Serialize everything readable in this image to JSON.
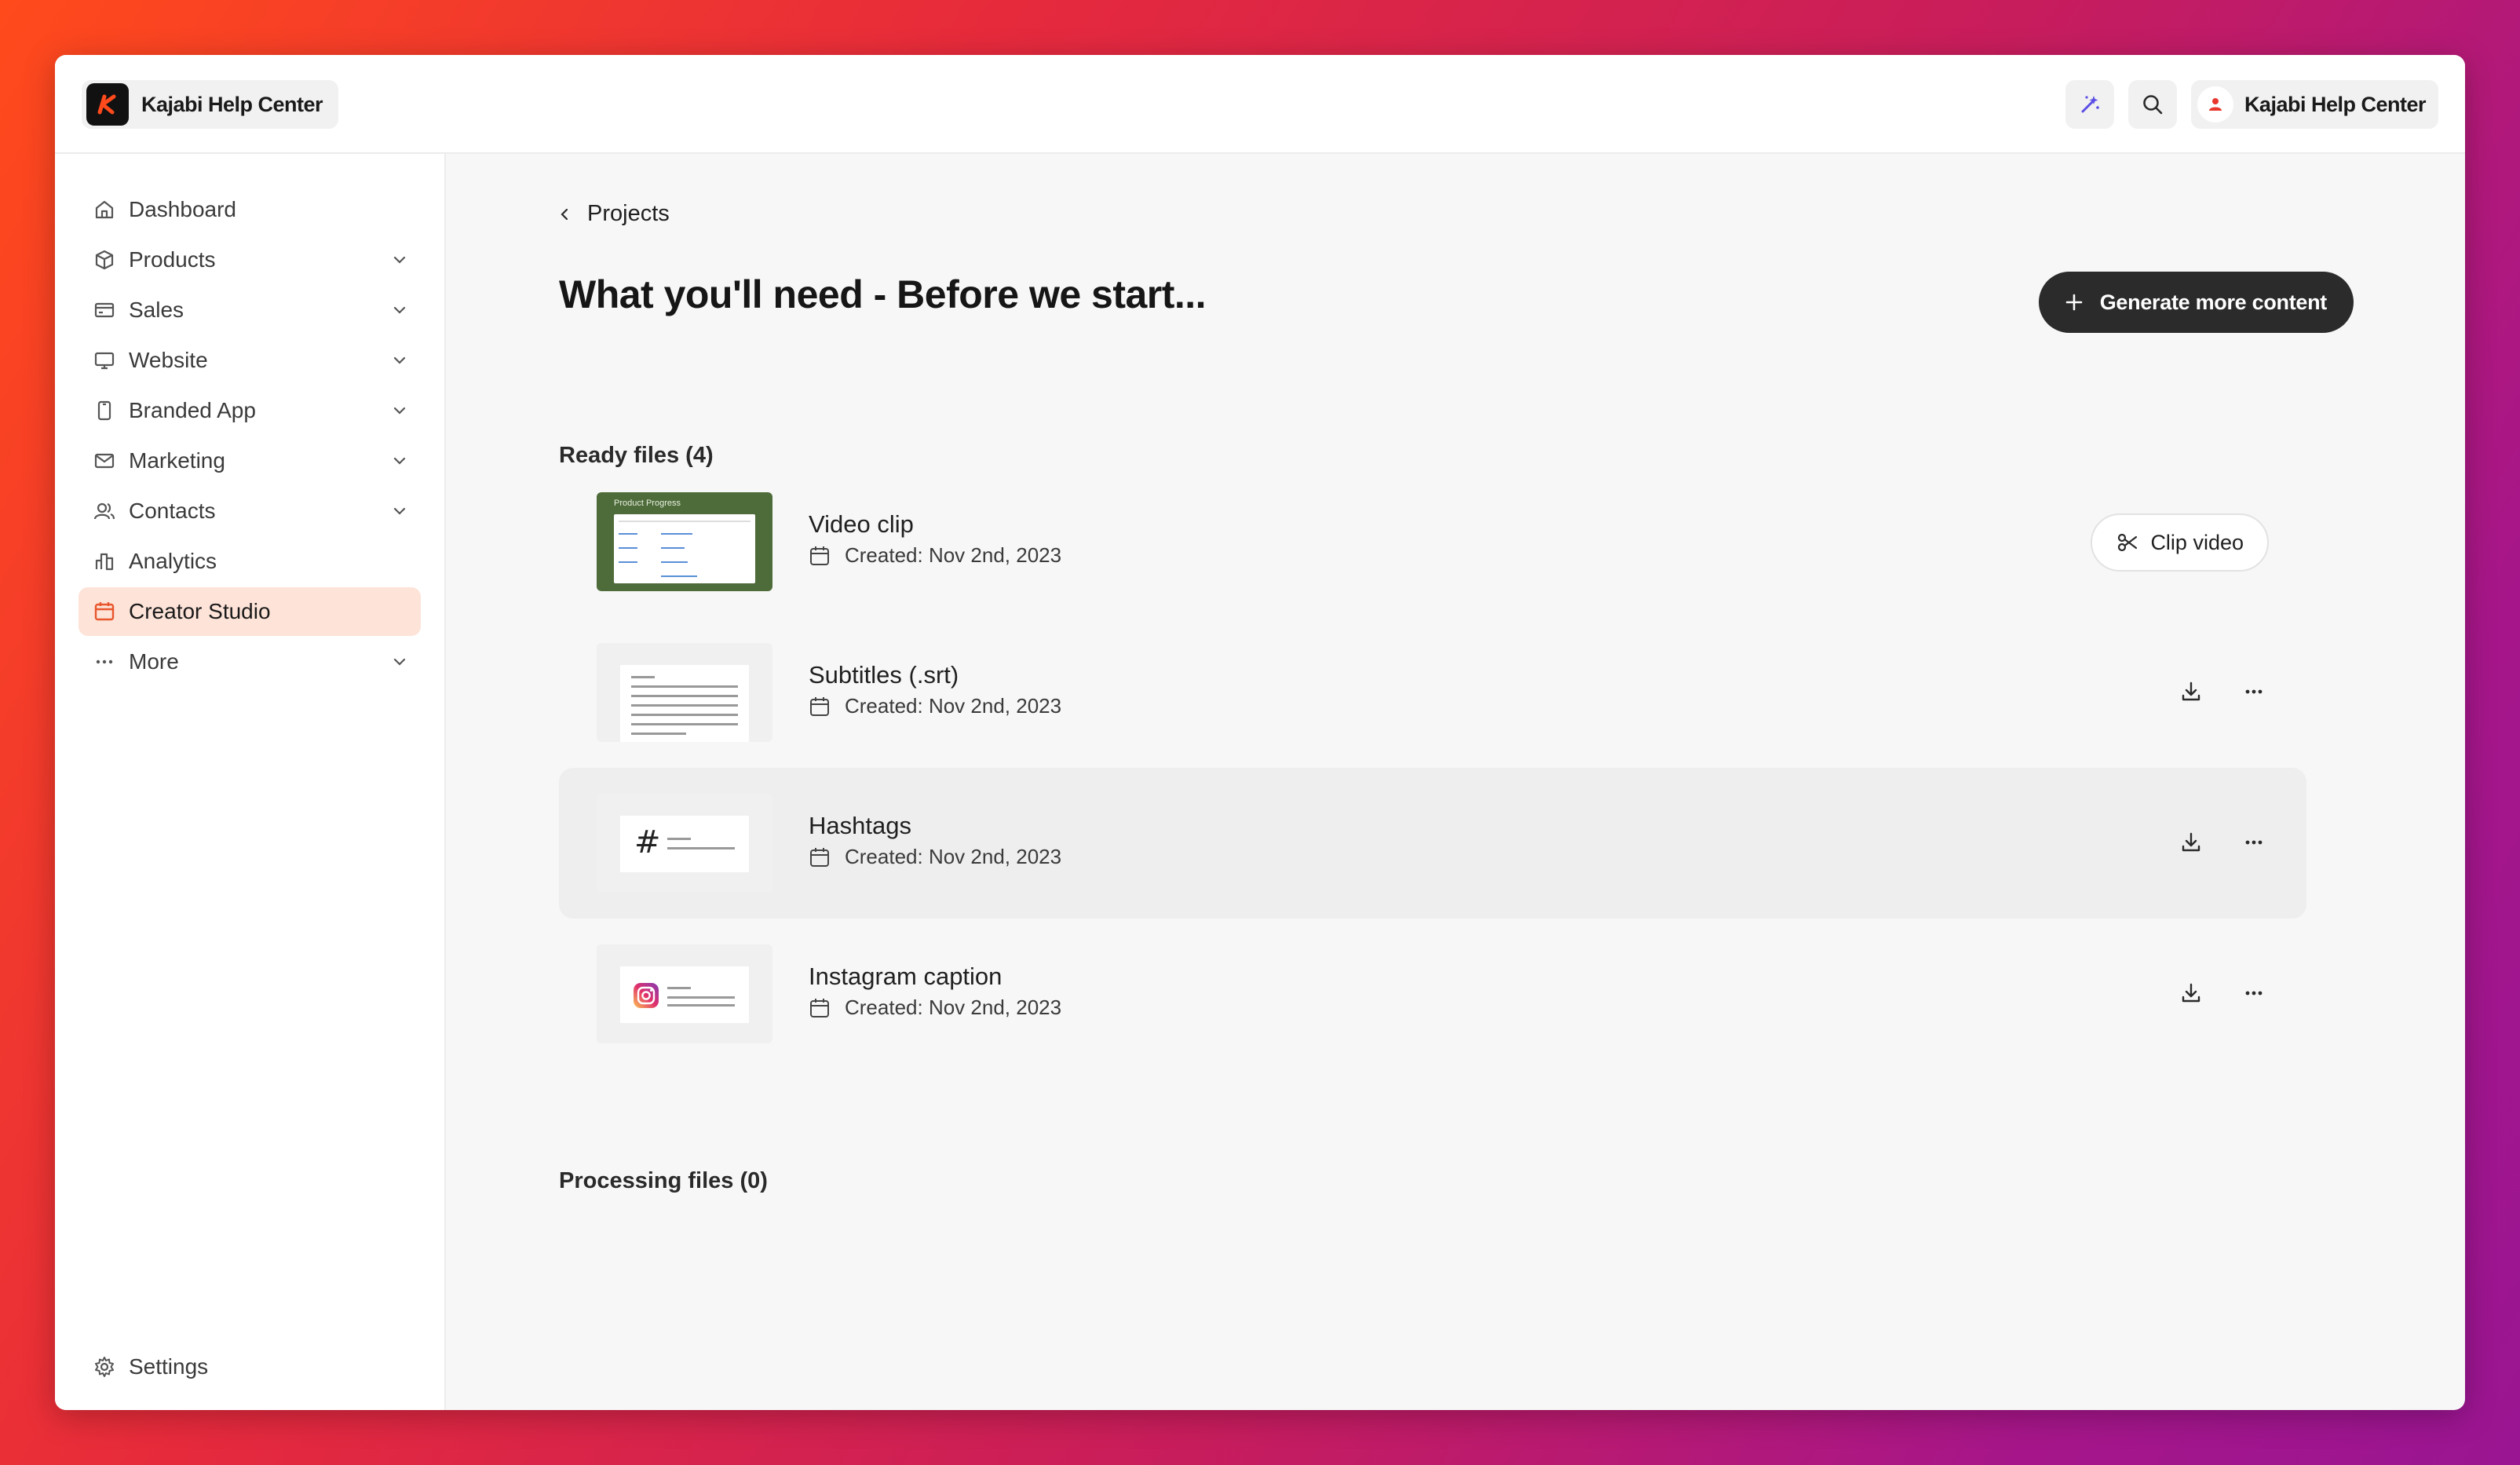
{
  "topbar": {
    "brand_name": "Kajabi Help Center",
    "user_name": "Kajabi Help Center",
    "icons": [
      "magic-wand-icon",
      "search-icon",
      "user-icon"
    ]
  },
  "sidebar": {
    "items": [
      {
        "label": "Dashboard",
        "icon": "home-icon",
        "expandable": false,
        "active": false
      },
      {
        "label": "Products",
        "icon": "box-icon",
        "expandable": true,
        "active": false
      },
      {
        "label": "Sales",
        "icon": "credit-card-icon",
        "expandable": true,
        "active": false
      },
      {
        "label": "Website",
        "icon": "monitor-icon",
        "expandable": true,
        "active": false
      },
      {
        "label": "Branded App",
        "icon": "phone-icon",
        "expandable": true,
        "active": false
      },
      {
        "label": "Marketing",
        "icon": "mail-icon",
        "expandable": true,
        "active": false
      },
      {
        "label": "Contacts",
        "icon": "users-icon",
        "expandable": true,
        "active": false
      },
      {
        "label": "Analytics",
        "icon": "bar-chart-icon",
        "expandable": false,
        "active": false
      },
      {
        "label": "Creator Studio",
        "icon": "calendar-icon",
        "expandable": false,
        "active": true
      },
      {
        "label": "More",
        "icon": "dots-icon",
        "expandable": true,
        "active": false
      }
    ],
    "settings_label": "Settings"
  },
  "main": {
    "breadcrumb": "Projects",
    "title": "What you'll need - Before we start...",
    "generate_button": "Generate more content",
    "ready_title": "Ready files (4)",
    "processing_title": "Processing files (0)",
    "files": [
      {
        "name": "Video clip",
        "created": "Created: Nov 2nd, 2023",
        "action": "Clip video",
        "thumb": "video",
        "thumb_title": "Product Progress"
      },
      {
        "name": "Subtitles (.srt)",
        "created": "Created: Nov 2nd, 2023",
        "thumb": "doc"
      },
      {
        "name": "Hashtags",
        "created": "Created: Nov 2nd, 2023",
        "thumb": "hashtag",
        "thumb_symbol": "#"
      },
      {
        "name": "Instagram caption",
        "created": "Created: Nov 2nd, 2023",
        "thumb": "instagram"
      }
    ]
  },
  "colors": {
    "accent": "#e8572d",
    "active_bg": "#fde3d8",
    "button_dark": "#2b2b2b",
    "video_thumb_bg": "#4e6b3a"
  }
}
